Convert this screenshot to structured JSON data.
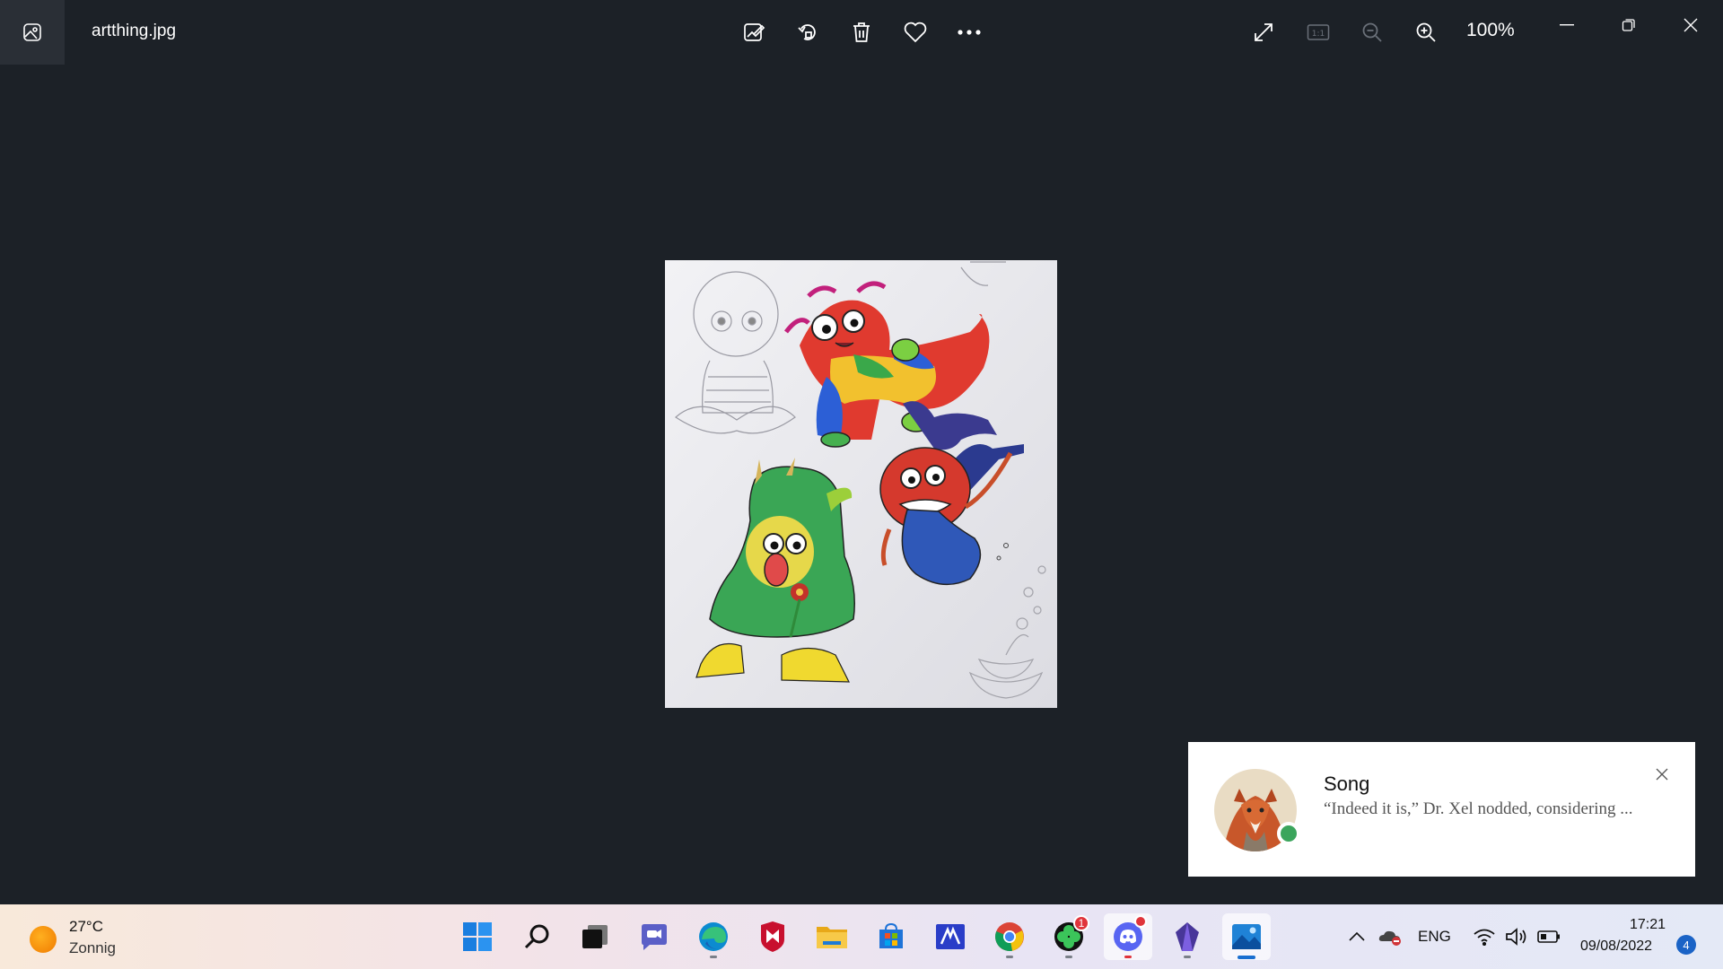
{
  "titlebar": {
    "filename": "artthing.jpg",
    "zoom": "100%"
  },
  "toolbar_icons": [
    "edit-image-icon",
    "rotate-icon",
    "delete-icon",
    "favorite-icon",
    "more-icon"
  ],
  "view_icons": [
    "fullscreen-icon",
    "actual-size-icon",
    "zoom-out-icon",
    "zoom-in-icon"
  ],
  "window_controls": [
    "minimize-icon",
    "restore-icon",
    "close-icon"
  ],
  "toast": {
    "title": "Song",
    "body": "“Indeed it is,” Dr. Xel nodded, considering ...",
    "status_color": "#3ba55c"
  },
  "taskbar": {
    "weather": {
      "temp": "27°C",
      "condition": "Zonnig"
    },
    "apps": [
      {
        "name": "start"
      },
      {
        "name": "search"
      },
      {
        "name": "task-view"
      },
      {
        "name": "chat"
      },
      {
        "name": "edge"
      },
      {
        "name": "mcafee"
      },
      {
        "name": "file-explorer"
      },
      {
        "name": "microsoft-store"
      },
      {
        "name": "visual-studio-code"
      },
      {
        "name": "chrome"
      },
      {
        "name": "clover"
      },
      {
        "name": "discord"
      },
      {
        "name": "obsidian"
      },
      {
        "name": "photos"
      }
    ],
    "clover_badge": "1",
    "language": "ENG",
    "time": "17:21",
    "date": "09/08/2022",
    "notification_count": "4"
  }
}
